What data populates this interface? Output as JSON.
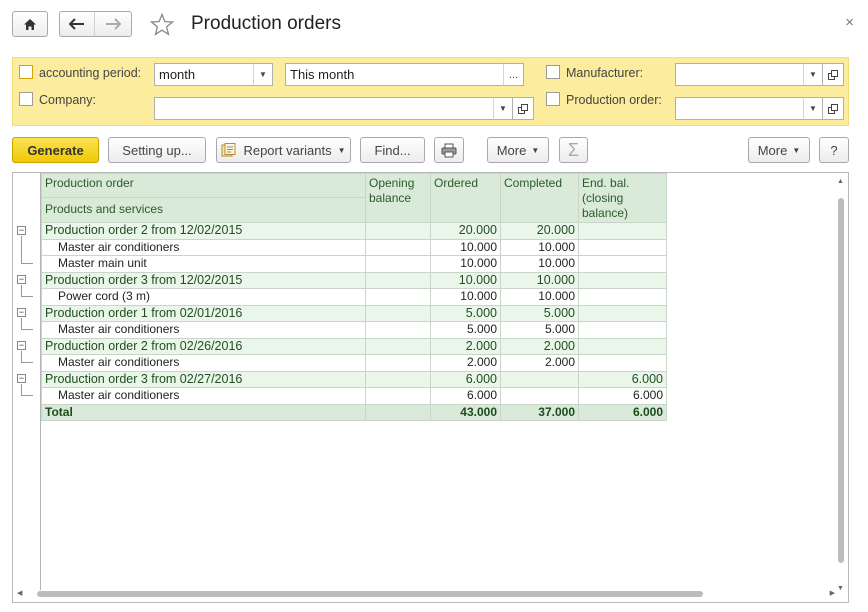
{
  "header": {
    "title": "Production orders",
    "close_glyph": "×"
  },
  "filters": {
    "accounting_period_label": "accounting period:",
    "period_unit_value": "month",
    "period_value": "This month",
    "period_more_label": "...",
    "company_label": "Company:",
    "company_value": "",
    "manufacturer_label": "Manufacturer:",
    "manufacturer_value": "",
    "production_order_label": "Production order:",
    "production_order_value": ""
  },
  "toolbar": {
    "generate_label": "Generate",
    "setting_up_label": "Setting up...",
    "report_variants_label": "Report variants",
    "find_label": "Find...",
    "more_label": "More",
    "more_right_label": "More",
    "help_label": "?",
    "sum_label": "Σ"
  },
  "report": {
    "headers": {
      "production_order": "Production order",
      "products_and_services": "Products and services",
      "opening_balance": "Opening balance",
      "ordered": "Ordered",
      "completed": "Completed",
      "end_bal": "End. bal. (closing balance)"
    },
    "rows": [
      {
        "type": "group",
        "name": "Production order 2 from 12/02/2015",
        "opening": "",
        "ordered": "20.000",
        "completed": "20.000",
        "end": ""
      },
      {
        "type": "item",
        "name": "Master air conditioners",
        "opening": "",
        "ordered": "10.000",
        "completed": "10.000",
        "end": ""
      },
      {
        "type": "item",
        "name": "Master main unit",
        "opening": "",
        "ordered": "10.000",
        "completed": "10.000",
        "end": ""
      },
      {
        "type": "group",
        "name": "Production order 3 from 12/02/2015",
        "opening": "",
        "ordered": "10.000",
        "completed": "10.000",
        "end": ""
      },
      {
        "type": "item",
        "name": "Power cord (3 m)",
        "opening": "",
        "ordered": "10.000",
        "completed": "10.000",
        "end": ""
      },
      {
        "type": "group",
        "name": "Production order 1 from 02/01/2016",
        "opening": "",
        "ordered": "5.000",
        "completed": "5.000",
        "end": ""
      },
      {
        "type": "item",
        "name": "Master air conditioners",
        "opening": "",
        "ordered": "5.000",
        "completed": "5.000",
        "end": ""
      },
      {
        "type": "group",
        "name": "Production order 2 from 02/26/2016",
        "opening": "",
        "ordered": "2.000",
        "completed": "2.000",
        "end": ""
      },
      {
        "type": "item",
        "name": "Master air conditioners",
        "opening": "",
        "ordered": "2.000",
        "completed": "2.000",
        "end": ""
      },
      {
        "type": "group",
        "name": "Production order 3 from 02/27/2016",
        "opening": "",
        "ordered": "6.000",
        "completed": "",
        "end": "6.000"
      },
      {
        "type": "item",
        "name": "Master air conditioners",
        "opening": "",
        "ordered": "6.000",
        "completed": "",
        "end": "6.000"
      }
    ],
    "total": {
      "name": "Total",
      "opening": "",
      "ordered": "43.000",
      "completed": "37.000",
      "end": "6.000"
    }
  },
  "colors": {
    "filter_panel": "#fcec9d",
    "generate_button": "#f5d21f",
    "header_bg": "#d9ead9",
    "group_bg": "#e9f6e9"
  },
  "icons": [
    "home-icon",
    "back-arrow-icon",
    "forward-arrow-icon",
    "star-icon",
    "print-icon",
    "report-variants-icon",
    "sum-icon",
    "open-icon",
    "dropdown-icon",
    "collapse-icon"
  ]
}
